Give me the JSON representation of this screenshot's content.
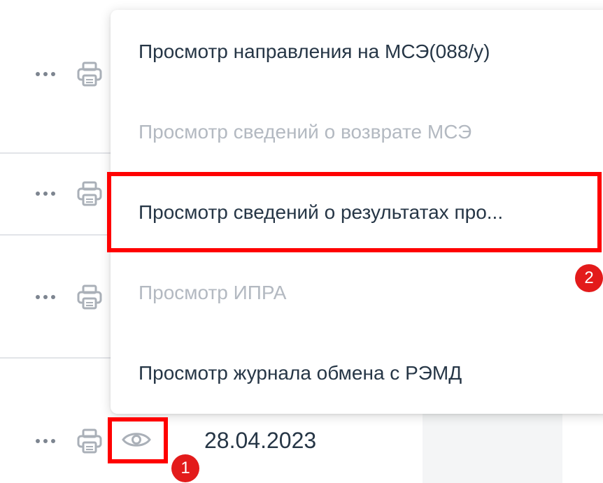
{
  "rows": [
    {
      "date": ""
    },
    {
      "date": ""
    },
    {
      "date": ""
    },
    {
      "date": "28.04.2023"
    }
  ],
  "context_menu": {
    "items": [
      {
        "label": "Просмотр направления на МСЭ(088/у)",
        "enabled": true
      },
      {
        "label": "Просмотр сведений о возврате МСЭ",
        "enabled": false
      },
      {
        "label": "Просмотр сведений о результатах про...",
        "enabled": true
      },
      {
        "label": "Просмотр ИПРА",
        "enabled": false
      },
      {
        "label": "Просмотр журнала обмена с РЭМД",
        "enabled": true
      }
    ]
  },
  "annotations": {
    "badge_1": "1",
    "badge_2": "2",
    "highlight_color": "#ff0000"
  },
  "icons": {
    "row_actions": [
      "more-horizontal-icon",
      "printer-icon"
    ],
    "view": "eye-icon"
  }
}
